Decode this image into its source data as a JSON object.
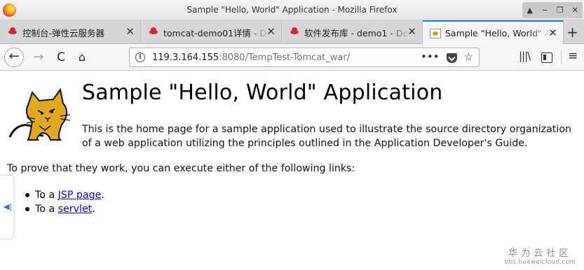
{
  "window": {
    "title": "Sample \"Hello, World\" Application - Mozilla Firefox",
    "controls": {
      "up": "▲",
      "minimize": "−",
      "restore": "❐",
      "close": "✕"
    }
  },
  "tabs": [
    {
      "label": "控制台-弹性云服务器",
      "icon": "huawei-icon",
      "active": false
    },
    {
      "label": "tomcat-demo01详情 - De",
      "icon": "huawei-icon",
      "active": false
    },
    {
      "label": "软件发布库 - demo1 - De",
      "icon": "huawei-icon",
      "active": false
    },
    {
      "label": "Sample \"Hello, World\" A",
      "icon": "tomcat-icon",
      "active": true
    }
  ],
  "tab_close_glyph": "✕",
  "new_tab_glyph": "+",
  "nav": {
    "back": "←",
    "forward": "→",
    "reload": "C",
    "home": "⌂",
    "url_host": "119.3.164.155",
    "url_rest": ":8080/TempTest-Tomcat_war/",
    "page_actions": "•••",
    "bookmark": "☆",
    "library": "|||\\",
    "menu": "≡"
  },
  "page": {
    "heading": "Sample \"Hello, World\" Application",
    "intro": "This is the home page for a sample application used to illustrate the source directory organization of a web application utilizing the principles outlined in the Application Developer's Guide.",
    "links_intro": "To prove that they work, you can execute either of the following links:",
    "links": [
      {
        "prefix": "To a ",
        "link_text": "JSP page",
        "suffix": "."
      },
      {
        "prefix": "To a ",
        "link_text": "servlet",
        "suffix": "."
      }
    ]
  },
  "side_tab": {
    "glyph": "◀|"
  },
  "watermark": {
    "title": "华为云社区",
    "subtitle": "bbs.huaweicloud.com"
  },
  "colors": {
    "link": "#0000ee",
    "active_tab_accent": "#0a84ff",
    "huawei_red": "#e0232b"
  }
}
